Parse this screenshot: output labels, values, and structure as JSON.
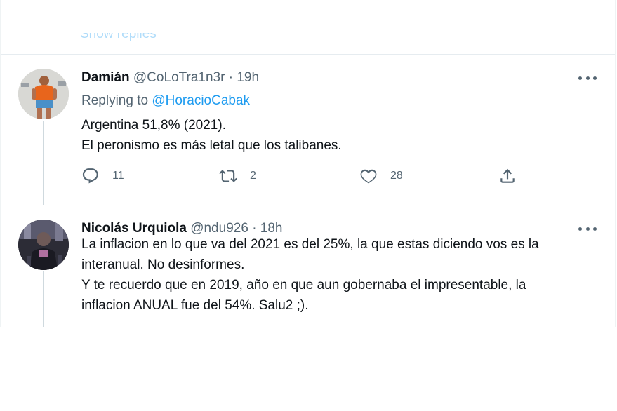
{
  "thread": {
    "show_replies_label": "Show replies"
  },
  "tweets": [
    {
      "name": "Damián",
      "handle": "@CoLoTra1n3r",
      "time": "· 19h",
      "replying_prefix": "Replying to",
      "replying_to": "@HoracioCabak",
      "lines": [
        "Argentina 51,8% (2021).",
        "El peronismo es más letal que los talibanes."
      ],
      "replies": "11",
      "retweets": "2",
      "likes": "28",
      "icons": [
        "reply-icon",
        "retweet-icon",
        "like-icon",
        "share-icon",
        "more-icon"
      ]
    },
    {
      "name": "Nicolás Urquiola",
      "handle": "@ndu926",
      "time": "· 18h",
      "lines": [
        "La inflacion en lo que va del 2021 es del 25%, la que estas diciendo vos es la",
        "interanual. No desinformes.",
        "Y te recuerdo que en 2019, año en que aun gobernaba el impresentable, la",
        "inflacion ANUAL fue del 54%. Salu2 ;)."
      ],
      "icons": [
        "more-icon"
      ]
    }
  ],
  "colors": {
    "accent": "#1d9bf0",
    "text": "#0f1419",
    "secondary": "#536471",
    "thread_line": "#cfd9de"
  }
}
